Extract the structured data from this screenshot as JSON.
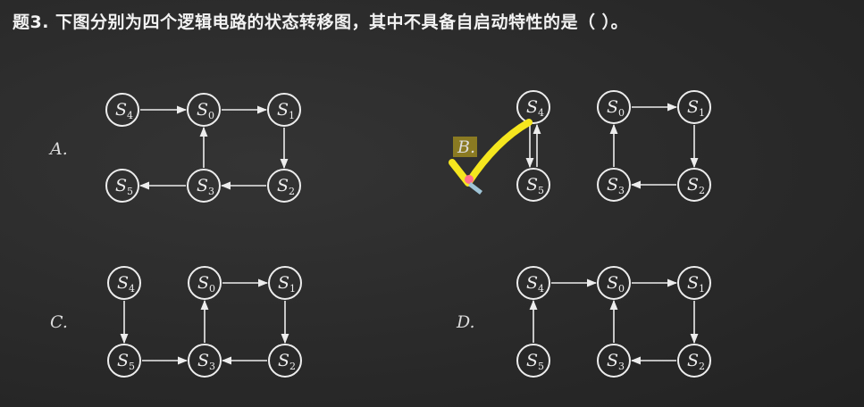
{
  "question": {
    "text": "题3. 下图分别为四个逻辑电路的状态转移图，其中不具备自启动特性的是（   ）。"
  },
  "marked_answer": "B",
  "colors": {
    "background": "#2b2b2b",
    "chalk": "#ededed",
    "check_mark": "#f5e61e",
    "answer_highlight": "#8a7a22"
  },
  "diagrams": [
    {
      "label": "A.",
      "states": [
        "S4",
        "S0",
        "S1",
        "S5",
        "S3",
        "S2"
      ],
      "transitions": [
        [
          "S4",
          "S0"
        ],
        [
          "S0",
          "S1"
        ],
        [
          "S1",
          "S2"
        ],
        [
          "S2",
          "S3"
        ],
        [
          "S3",
          "S0"
        ],
        [
          "S3",
          "S5"
        ]
      ]
    },
    {
      "label": "B.",
      "states": [
        "S4",
        "S5",
        "S0",
        "S1",
        "S3",
        "S2"
      ],
      "transitions": [
        [
          "S4",
          "S5"
        ],
        [
          "S5",
          "S4"
        ],
        [
          "S0",
          "S1"
        ],
        [
          "S1",
          "S2"
        ],
        [
          "S2",
          "S3"
        ],
        [
          "S3",
          "S0"
        ]
      ]
    },
    {
      "label": "C.",
      "states": [
        "S4",
        "S0",
        "S1",
        "S5",
        "S3",
        "S2"
      ],
      "transitions": [
        [
          "S4",
          "S5"
        ],
        [
          "S5",
          "S3"
        ],
        [
          "S3",
          "S0"
        ],
        [
          "S0",
          "S1"
        ],
        [
          "S1",
          "S2"
        ],
        [
          "S2",
          "S3"
        ]
      ]
    },
    {
      "label": "D.",
      "states": [
        "S4",
        "S0",
        "S1",
        "S5",
        "S3",
        "S2"
      ],
      "transitions": [
        [
          "S4",
          "S0"
        ],
        [
          "S0",
          "S1"
        ],
        [
          "S1",
          "S2"
        ],
        [
          "S2",
          "S3"
        ],
        [
          "S3",
          "S0"
        ],
        [
          "S5",
          "S4"
        ]
      ]
    }
  ]
}
